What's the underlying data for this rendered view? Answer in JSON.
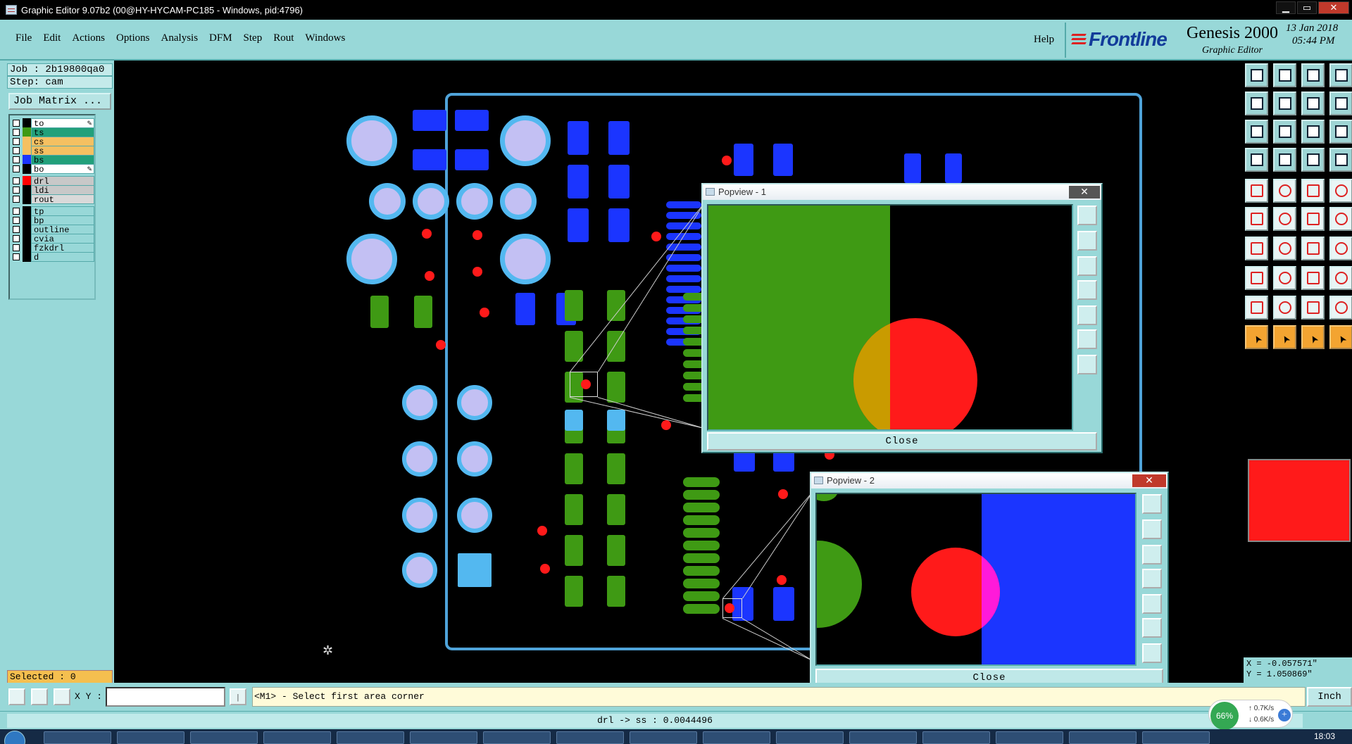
{
  "window": {
    "title": "Graphic Editor 9.07b2 (00@HY-HYCAM-PC185 - Windows, pid:4796)"
  },
  "menu": {
    "items": [
      "File",
      "Edit",
      "Actions",
      "Options",
      "Analysis",
      "DFM",
      "Step",
      "Rout",
      "Windows"
    ],
    "help": "Help"
  },
  "brand": {
    "logo_text": "Frontline",
    "product": "Genesis 2000",
    "subtitle": "Graphic Editor",
    "date": "13 Jan 2018",
    "time": "05:44 PM"
  },
  "job": {
    "job_line": "Job : 2b19800qa0",
    "step_line": "Step: cam",
    "matrix_button": "Job Matrix ..."
  },
  "layers": [
    {
      "name": "to",
      "color": "#000000",
      "bg": "#ffffff",
      "editable": true
    },
    {
      "name": "ts",
      "color": "#3f9a14",
      "bg": "#22a07a",
      "editable": false
    },
    {
      "name": "cs",
      "color": "#f5c061",
      "bg": "#f5c061",
      "editable": false
    },
    {
      "name": "ss",
      "color": "#f5c061",
      "bg": "#f5c061",
      "editable": false
    },
    {
      "name": "bs",
      "color": "#1b35ff",
      "bg": "#22a07a",
      "editable": false
    },
    {
      "name": "bo",
      "color": "#000000",
      "bg": "#ffffff",
      "editable": true
    },
    {
      "name": "drl",
      "color": "#ff0000",
      "bg": "#c8c8c8",
      "editable": false
    },
    {
      "name": "ldi",
      "color": "#000000",
      "bg": "#c8c8c8",
      "editable": false
    },
    {
      "name": "rout",
      "color": "#000000",
      "bg": "#d9d9d9",
      "editable": false
    },
    {
      "name": "tp",
      "color": "#000000",
      "bg": "#98d8d8",
      "editable": false
    },
    {
      "name": "bp",
      "color": "#000000",
      "bg": "#98d8d8",
      "editable": false
    },
    {
      "name": "outline",
      "color": "#000000",
      "bg": "#98d8d8",
      "editable": false
    },
    {
      "name": "cvia",
      "color": "#000000",
      "bg": "#98d8d8",
      "editable": false
    },
    {
      "name": "fzkdrl",
      "color": "#000000",
      "bg": "#98d8d8",
      "editable": false
    },
    {
      "name": "d",
      "color": "#000000",
      "bg": "#98d8d8",
      "editable": false
    }
  ],
  "selected": "Selected : 0",
  "popview1": {
    "title": "Popview - 1",
    "close": "Close"
  },
  "popview2": {
    "title": "Popview - 2",
    "close": "Close"
  },
  "coords": {
    "x": "X = -0.057571\"",
    "y": "Y = 1.050869\""
  },
  "command": {
    "xy_label": "X Y :",
    "xy_value": "",
    "prompt": "<M1> - Select first area corner",
    "units": "Inch"
  },
  "status": "drl -> ss : 0.0044496",
  "network": {
    "percent": "66%",
    "up": "0.7K/s",
    "down": "0.6K/s"
  },
  "tray_time": "18:03",
  "colors": {
    "panel": "#98d8d8",
    "board_outline": "#4fa3d9",
    "pad_light": "#c3c0f3",
    "pad_ring": "#53b8f0",
    "smd_blue": "#1b35ff",
    "smd_green": "#3f9a14",
    "drill_red": "#ff1a1a"
  }
}
